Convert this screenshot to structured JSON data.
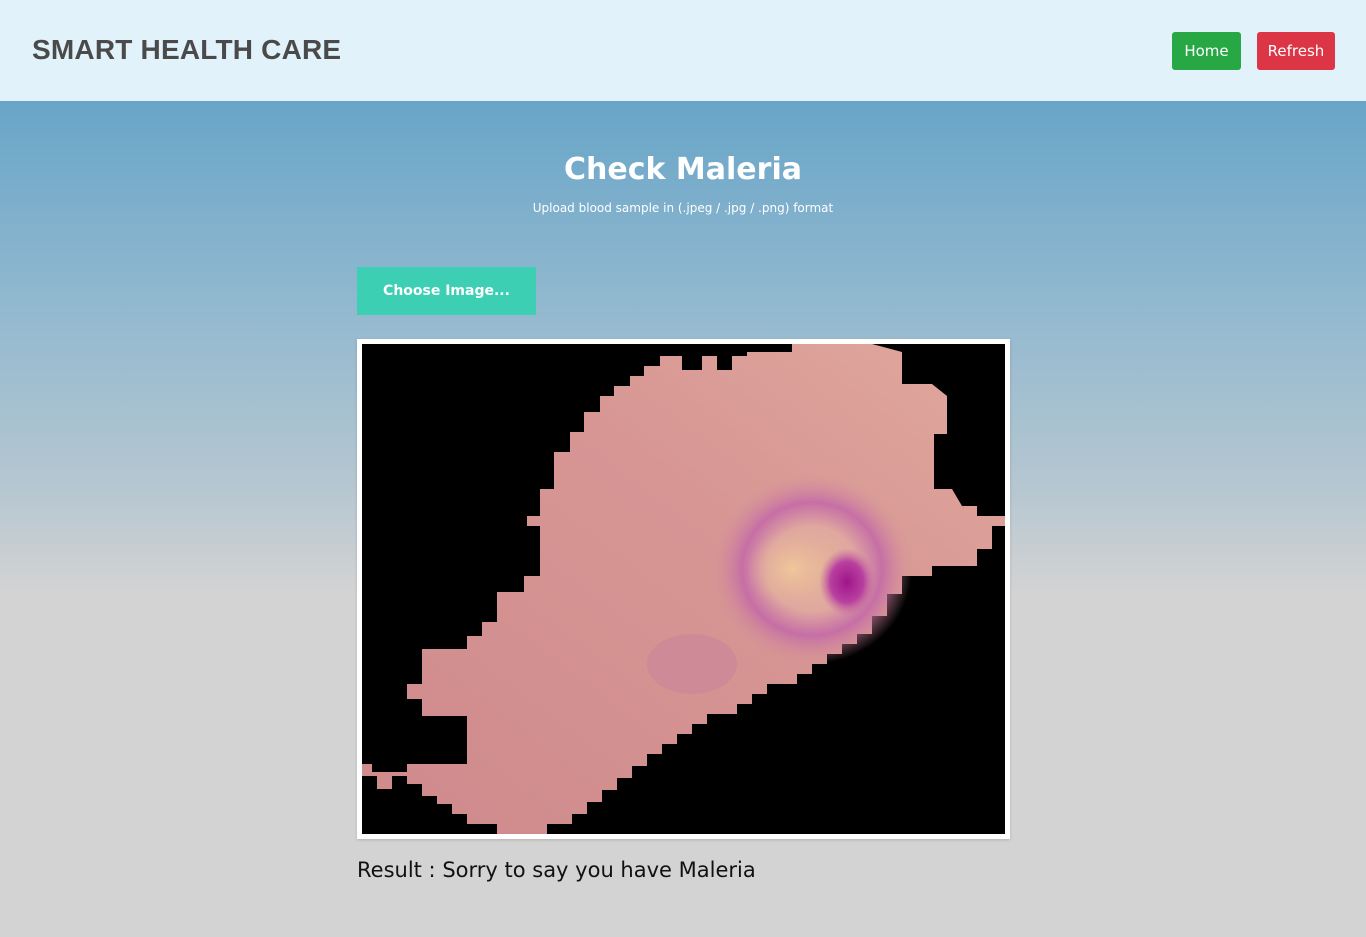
{
  "navbar": {
    "brand": "SMART HEALTH CARE",
    "home_label": "Home",
    "refresh_label": "Refresh"
  },
  "main": {
    "title": "Check Maleria",
    "subtitle": "Upload blood sample in (.jpeg / .jpg / .png) format",
    "choose_label": "Choose Image...",
    "result_text": "Result : Sorry to say you have Maleria"
  },
  "colors": {
    "home_button": "#28a745",
    "refresh_button": "#dc3545",
    "choose_button": "#3ccfb4",
    "brand_text": "#4a4a4a"
  }
}
